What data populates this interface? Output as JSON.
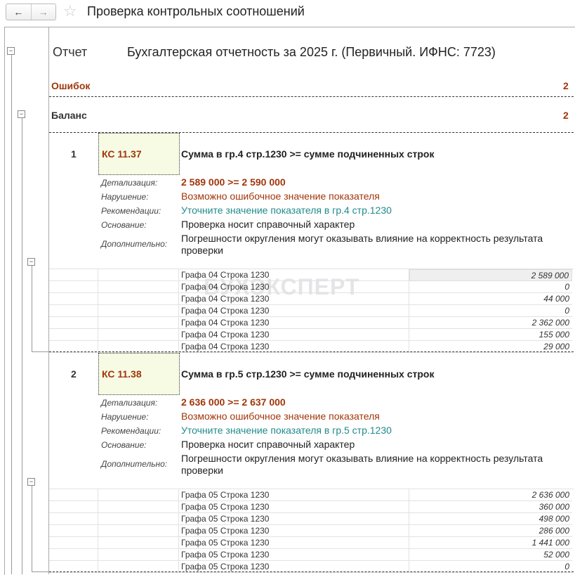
{
  "toolbar": {
    "back": "←",
    "forward": "→",
    "favorite_icon": "star-icon",
    "title": "Проверка контрольных соотношений"
  },
  "report": {
    "label": "Отчет",
    "value": "Бухгалтерская отчетность за 2025 г. (Первичный. ИФНС: 7723)"
  },
  "errors": {
    "label": "Ошибок",
    "count": "2"
  },
  "group": {
    "label": "Баланс",
    "count": "2"
  },
  "watermark": "БУХЭКСПЕРТ",
  "labels": {
    "detail": "Детализация:",
    "violation": "Нарушение:",
    "recommend": "Рекомендации:",
    "basis": "Основание:",
    "extra": "Дополнительно:"
  },
  "checks": [
    {
      "num": "1",
      "code": "КС 11.37",
      "title": "Сумма в гр.4 стр.1230 >= сумме подчиненных строк",
      "detail": "2 589 000 >= 2 590 000",
      "violation": "Возможно ошибочное значение показателя",
      "recommend": "Уточните значение показателя в гр.4 стр.1230",
      "basis": "Проверка носит справочный характер",
      "extra": "Погрешности округления могут оказывать влияние на корректность результата проверки",
      "rows": [
        [
          "Графа 04 Строка 1230",
          "2 589 000"
        ],
        [
          "Графа 04 Строка 1230",
          "0"
        ],
        [
          "Графа 04 Строка 1230",
          "44 000"
        ],
        [
          "Графа 04 Строка 1230",
          "0"
        ],
        [
          "Графа 04 Строка 1230",
          "2 362 000"
        ],
        [
          "Графа 04 Строка 1230",
          "155 000"
        ],
        [
          "Графа 04 Строка 1230",
          "29 000"
        ]
      ]
    },
    {
      "num": "2",
      "code": "КС 11.38",
      "title": "Сумма в гр.5 стр.1230 >= сумме подчиненных строк",
      "detail": "2 636 000 >= 2 637 000",
      "violation": "Возможно ошибочное значение показателя",
      "recommend": "Уточните значение показателя в гр.5 стр.1230",
      "basis": "Проверка носит справочный характер",
      "extra": "Погрешности округления могут оказывать влияние на корректность результата проверки",
      "rows": [
        [
          "Графа 05 Строка 1230",
          "2 636 000"
        ],
        [
          "Графа 05 Строка 1230",
          "360 000"
        ],
        [
          "Графа 05 Строка 1230",
          "498 000"
        ],
        [
          "Графа 05 Строка 1230",
          "286 000"
        ],
        [
          "Графа 05 Строка 1230",
          "1 441 000"
        ],
        [
          "Графа 05 Строка 1230",
          "52 000"
        ],
        [
          "Графа 05 Строка 1230",
          "0"
        ]
      ]
    }
  ]
}
